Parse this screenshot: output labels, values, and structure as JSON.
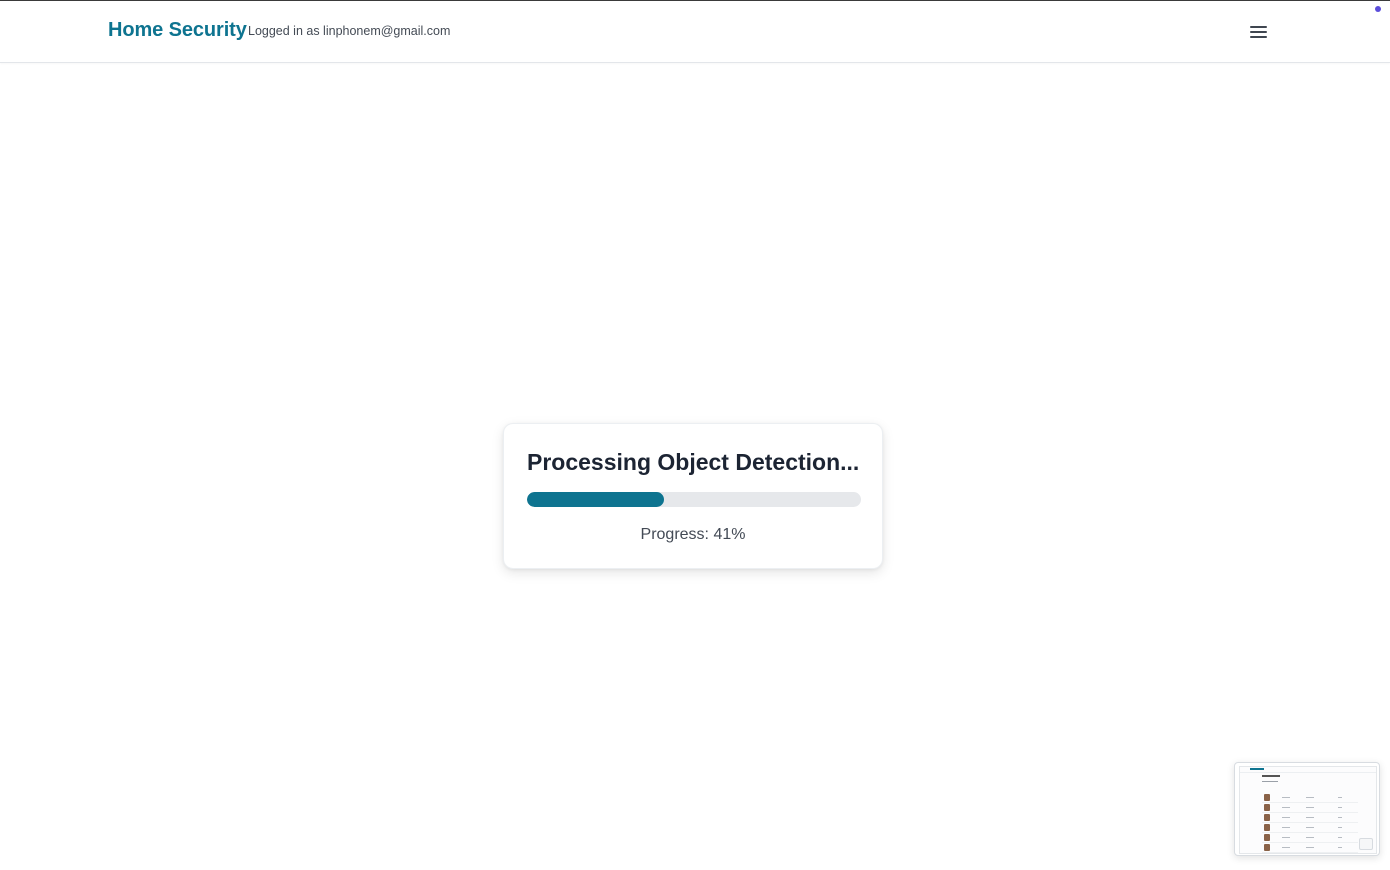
{
  "header": {
    "brand": "Home Security",
    "user_text": "Logged in as linphonem@gmail.com",
    "menu_icon": "hamburger-menu-icon"
  },
  "processing": {
    "title": "Processing Object Detection...",
    "progress_value": 41,
    "progress_text": "Progress: 41%"
  },
  "colors": {
    "accent": "#0e7490",
    "track": "#e6e8eb",
    "title_text": "#1c2433",
    "indicator_dot": "#5b4ddb"
  },
  "thumbnail": {
    "icon": "magnifier-icon",
    "rows": 6
  }
}
